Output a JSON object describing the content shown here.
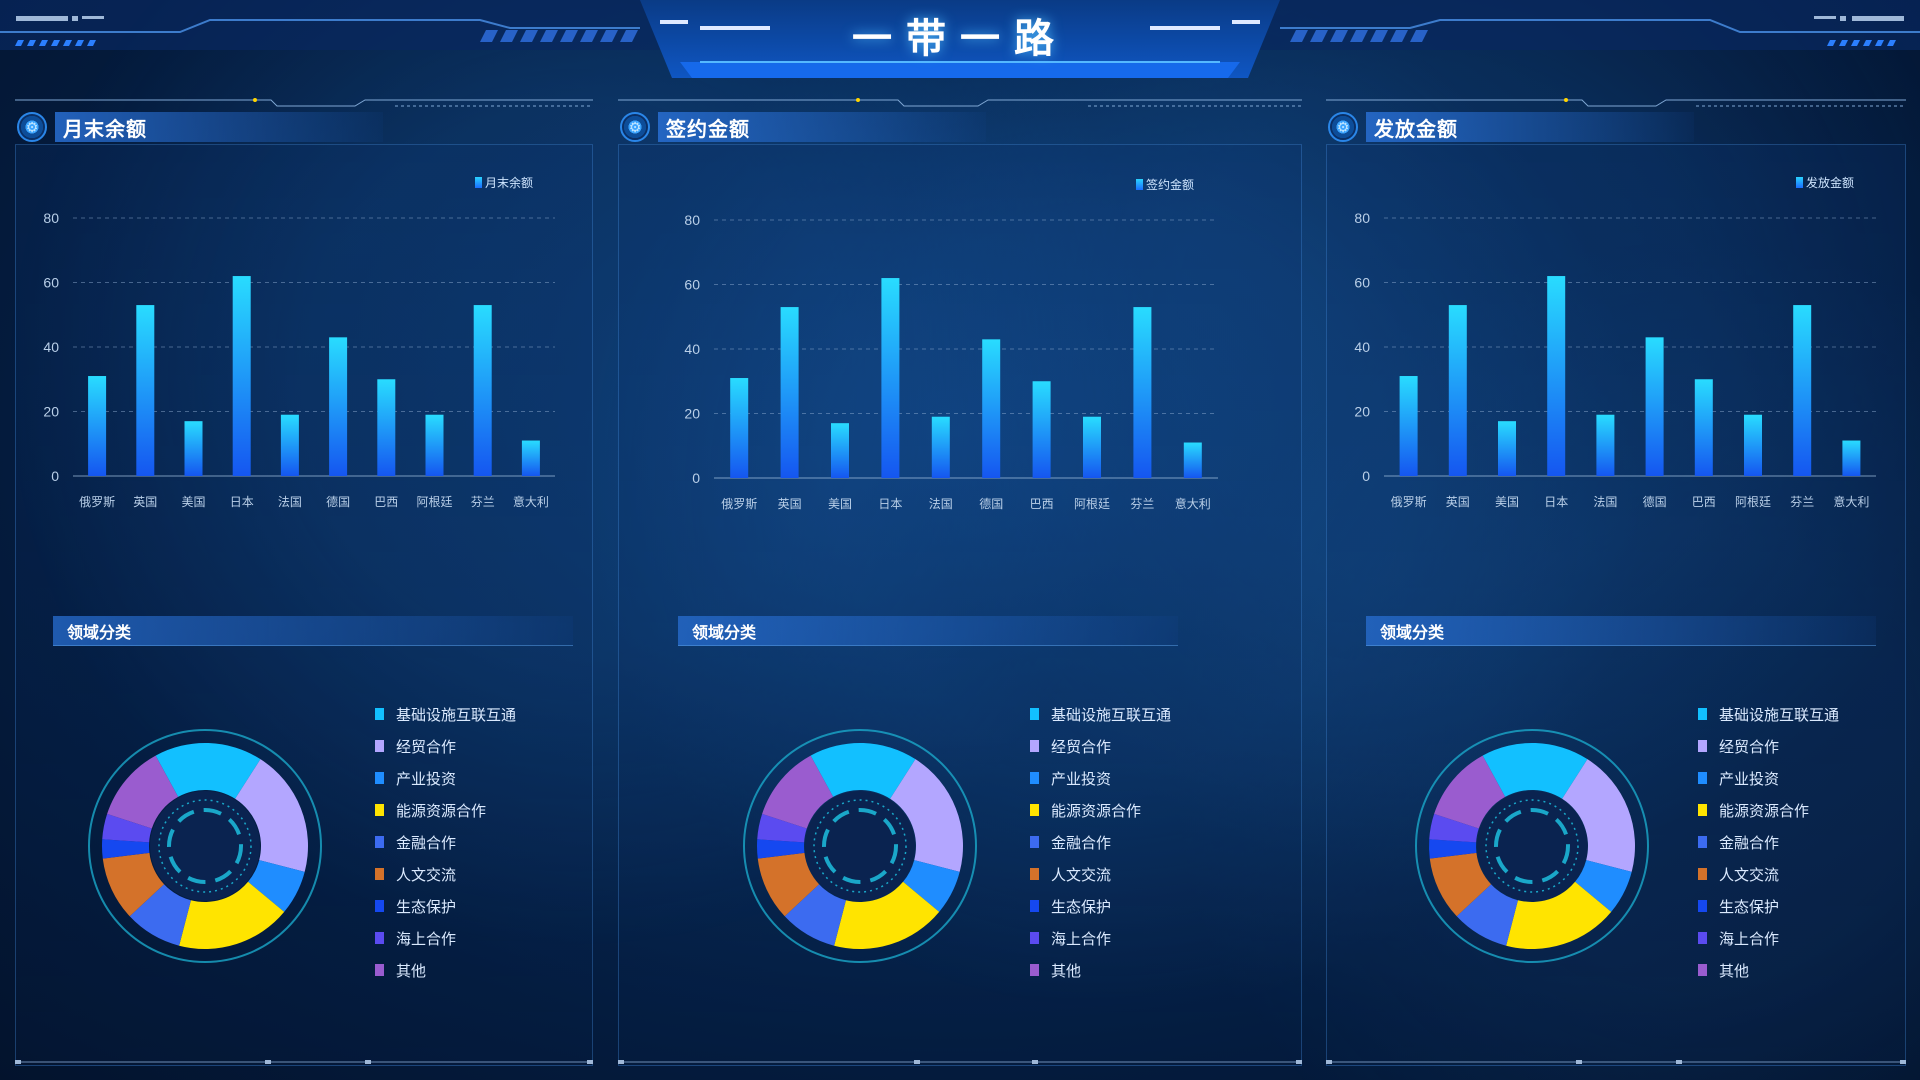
{
  "header": {
    "title": "一带一路"
  },
  "categories": [
    "俄罗斯",
    "英国",
    "美国",
    "日本",
    "法国",
    "德国",
    "巴西",
    "阿根廷",
    "芬兰",
    "意大利"
  ],
  "pie_legend": [
    {
      "label": "基础设施互联互通",
      "color": "#12c0ff"
    },
    {
      "label": "经贸合作",
      "color": "#b3a6ff"
    },
    {
      "label": "产业投资",
      "color": "#1f8dff"
    },
    {
      "label": "能源资源合作",
      "color": "#ffe400"
    },
    {
      "label": "金融合作",
      "color": "#3c6bf0"
    },
    {
      "label": "人文交流",
      "color": "#d4722a"
    },
    {
      "label": "生态保护",
      "color": "#1548f0"
    },
    {
      "label": "海上合作",
      "color": "#5b4bf0"
    },
    {
      "label": "其他",
      "color": "#9a5ccf"
    }
  ],
  "section_title": "领域分类",
  "panels": [
    {
      "title": "月末余额",
      "legend": "月末余额"
    },
    {
      "title": "签约金额",
      "legend": "签约金额"
    },
    {
      "title": "发放金额",
      "legend": "发放金额"
    }
  ],
  "chart_data": [
    {
      "type": "bar",
      "title": "",
      "legend": [
        "月末余额"
      ],
      "categories": [
        "俄罗斯",
        "英国",
        "美国",
        "日本",
        "法国",
        "德国",
        "巴西",
        "阿根廷",
        "芬兰",
        "意大利"
      ],
      "values": [
        31,
        53,
        17,
        62,
        19,
        43,
        30,
        19,
        53,
        11
      ],
      "ylim": [
        0,
        80
      ],
      "yticks": [
        0,
        20,
        40,
        60,
        80
      ],
      "grid": true
    },
    {
      "type": "bar",
      "title": "",
      "legend": [
        "签约金额"
      ],
      "categories": [
        "俄罗斯",
        "英国",
        "美国",
        "日本",
        "法国",
        "德国",
        "巴西",
        "阿根廷",
        "芬兰",
        "意大利"
      ],
      "values": [
        31,
        53,
        17,
        62,
        19,
        43,
        30,
        19,
        53,
        11
      ],
      "ylim": [
        0,
        80
      ],
      "yticks": [
        0,
        20,
        40,
        60,
        80
      ],
      "grid": true
    },
    {
      "type": "bar",
      "title": "",
      "legend": [
        "发放金额"
      ],
      "categories": [
        "俄罗斯",
        "英国",
        "美国",
        "日本",
        "法国",
        "德国",
        "巴西",
        "阿根廷",
        "芬兰",
        "意大利"
      ],
      "values": [
        31,
        53,
        17,
        62,
        19,
        43,
        30,
        19,
        53,
        11
      ],
      "ylim": [
        0,
        80
      ],
      "yticks": [
        0,
        20,
        40,
        60,
        80
      ],
      "grid": true
    },
    {
      "type": "pie",
      "title": "领域分类",
      "labels": [
        "基础设施互联互通",
        "经贸合作",
        "产业投资",
        "能源资源合作",
        "金融合作",
        "人文交流",
        "生态保护",
        "海上合作",
        "其他"
      ],
      "values": [
        17,
        20,
        7,
        18,
        9,
        10,
        3,
        4,
        12
      ]
    }
  ]
}
